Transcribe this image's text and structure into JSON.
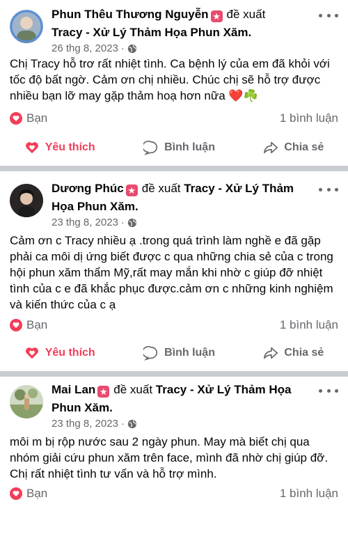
{
  "posts": [
    {
      "author": "Phun Thêu Thương Nguyễn",
      "verb": "đề xuất",
      "page": "Tracy - Xử Lý Thảm Họa Phun Xăm.",
      "date": "26 thg 8, 2023",
      "text": "Chị Tracy hỗ trơ rất nhiệt tình. Ca bệnh lý của em đã khỏi với tốc độ bất ngờ. Cảm ơn chị nhiều. Chúc chị sẽ hỗ trợ được nhiều bạn lỡ may gặp thảm hoạ hơn nữa",
      "emoji": "❤️☘️",
      "reaction_label": "Bạn",
      "comments": "1 bình luận",
      "actions": {
        "like": "Yêu thích",
        "comment": "Bình luận",
        "share": "Chia sẻ"
      }
    },
    {
      "author": "Dương Phúc",
      "verb": "đề xuất",
      "page": "Tracy - Xử Lý Thảm Họa Phun Xăm.",
      "date": "23 thg 8, 2023",
      "text": "Cảm ơn c Tracy nhiều ạ .trong quá trình làm nghề e đã gặp phải ca môi dị ứng biết được c qua những chia sẻ của c trong hội phun xăm thẩm Mỹ,rất may mắn khi nhờ c giúp đỡ nhiệt tình của c e đã khắc phục được.cảm ơn c những kinh nghiệm và kiến thức của c ạ",
      "reaction_label": "Bạn",
      "comments": "1 bình luận",
      "actions": {
        "like": "Yêu thích",
        "comment": "Bình luận",
        "share": "Chia sẻ"
      }
    },
    {
      "author": "Mai Lan",
      "verb": "đề xuất",
      "page": "Tracy - Xử Lý Thảm Họa Phun Xăm.",
      "date": "23 thg 8, 2023",
      "text": "môi m bị rộp nước sau 2 ngày phun.  May mà biết chị qua nhóm giải cứu phun xăm trên face, mình đã nhờ chị giúp đỡ. Chị rất nhiệt tình tư vấn và hỗ trợ mình.",
      "reaction_label": "Bạn",
      "comments": "1 bình luận"
    }
  ],
  "icons": {
    "badge": "star-badge-icon",
    "privacy": "globe-icon",
    "reaction": "heart-icon",
    "like": "heart-outline-icon",
    "comment": "comment-bubble-icon",
    "share": "share-arrow-icon",
    "more": "more-dots-icon"
  },
  "colors": {
    "like_red": "#f33e58",
    "badge": "#e84b6f",
    "meta_gray": "#65676b",
    "separator": "#c9ccd1"
  }
}
